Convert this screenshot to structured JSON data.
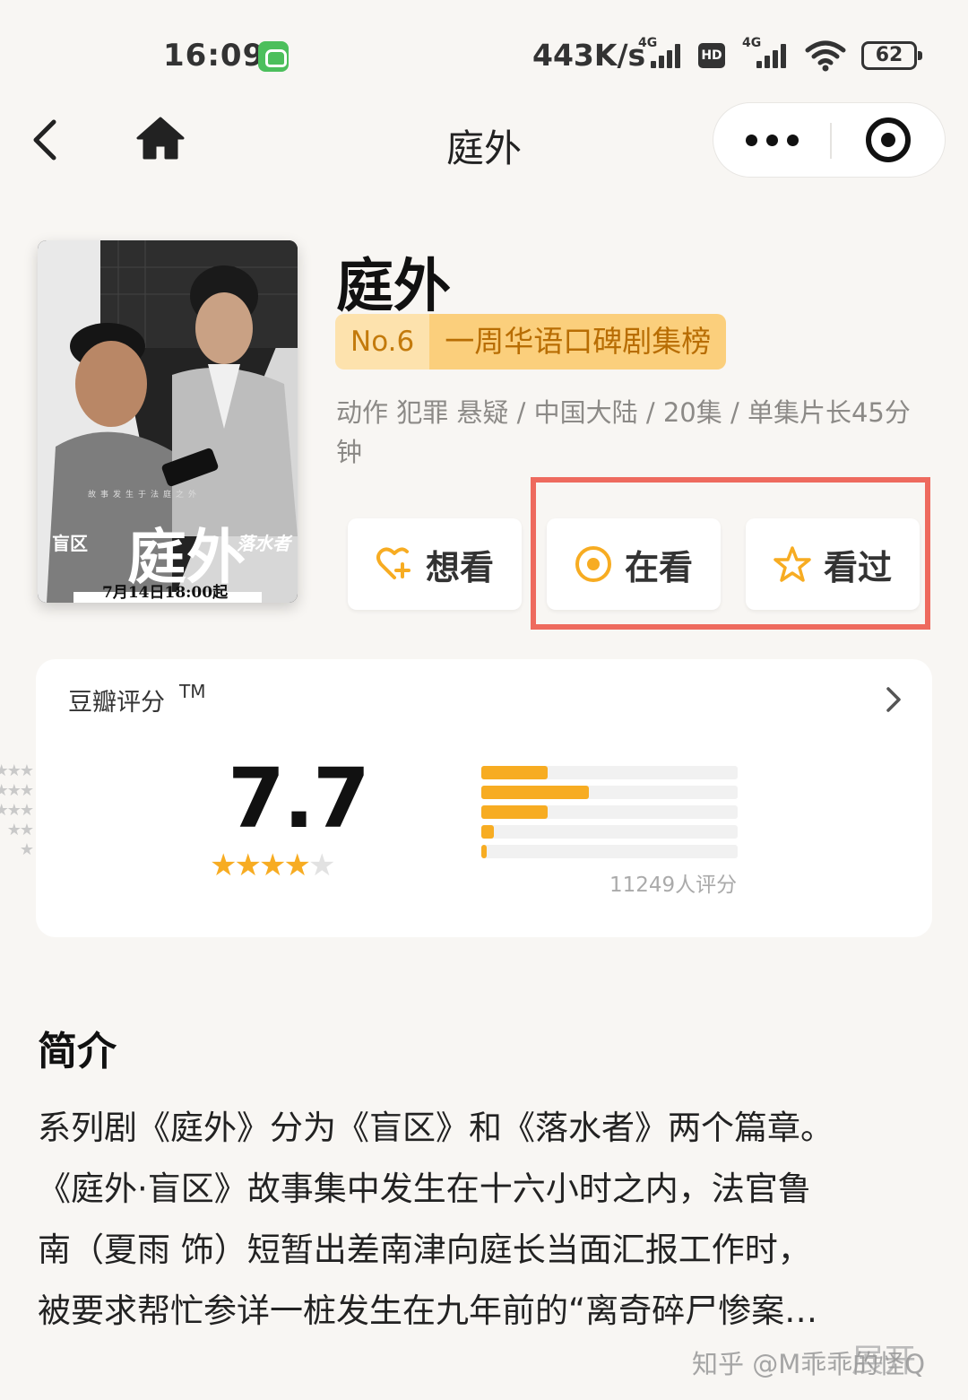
{
  "status_bar": {
    "time": "16:09",
    "speed": "443K/s",
    "network_label_1": "4G",
    "hd_label": "HD",
    "network_label_2": "4G",
    "battery": "62"
  },
  "nav": {
    "title": "庭外",
    "icons": [
      "back-icon",
      "home-icon",
      "more-icon",
      "close-icon"
    ]
  },
  "movie": {
    "title": "庭外",
    "rank_no": "No.6",
    "rank_label": "一周华语口碑剧集榜",
    "meta": "动作 犯罪 悬疑 / 中国大陆 / 20集 / 单集片长45分钟",
    "poster": {
      "title_text": "庭外",
      "left_tag": "盲区",
      "right_tag": "落水者",
      "tagline": "故事发生于法庭之外",
      "date_text": "7月14日18:00起"
    }
  },
  "actions": [
    {
      "label": "想看",
      "icon": "heart-plus-icon"
    },
    {
      "label": "在看",
      "icon": "target-icon"
    },
    {
      "label": "看过",
      "icon": "star-outline-icon"
    }
  ],
  "rating": {
    "title": "豆瓣评分",
    "tm": "TM",
    "score": "7.7",
    "star_level": 4,
    "distribution": [
      {
        "stars": 5,
        "percent": 26
      },
      {
        "stars": 4,
        "percent": 42
      },
      {
        "stars": 3,
        "percent": 26
      },
      {
        "stars": 2,
        "percent": 5
      },
      {
        "stars": 1,
        "percent": 2
      }
    ],
    "count_text": "11249人评分"
  },
  "intro": {
    "heading": "简介",
    "lines": [
      "系列剧《庭外》分为《盲区》和《落水者》两个篇章。",
      "《庭外·盲区》故事集中发生在十六小时之内，法官鲁",
      "南（夏雨 饰）短暂出差南津向庭长当面汇报工作时，",
      "被要求帮忙参详一桩发生在九年前的“离奇碎尸惨案…"
    ],
    "expand_label": "展开"
  },
  "watermark": "知乎 @M乖乖的怪Q",
  "colors": {
    "accent": "#f7ac22",
    "highlight_border": "#ee6a5e",
    "background": "#f8f6f3"
  }
}
